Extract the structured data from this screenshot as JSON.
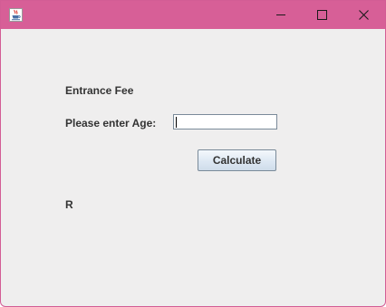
{
  "window": {
    "title": "",
    "titlebar_color": "#d75f97",
    "icon": "java-cup-icon",
    "controls": [
      "minimize-icon",
      "maximize-icon",
      "close-icon"
    ]
  },
  "form": {
    "title_label": "Entrance Fee",
    "age_label": "Please enter Age:",
    "age_value": "",
    "calculate_label": "Calculate",
    "result_label": "R"
  }
}
